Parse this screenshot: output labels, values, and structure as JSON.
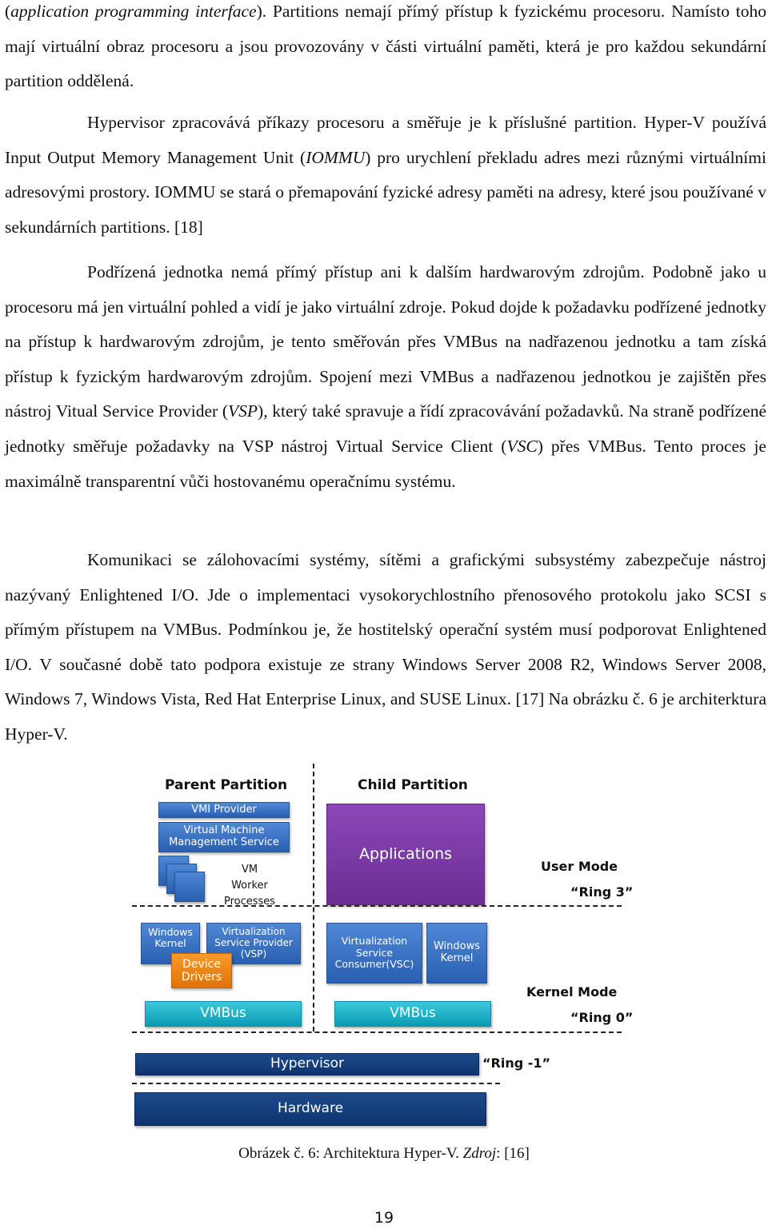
{
  "paragraphs": {
    "p1": {
      "italic_lead": "application programming interface",
      "open_paren": "(",
      "after_lead": "). Partitions nemají přímý přístup k fyzickému procesoru. Namísto toho mají virtuální obraz procesoru a jsou provozovány v části virtuální paměti, která je pro každou sekundární partition oddělená."
    },
    "p2": {
      "part1": "Hypervisor zpracovává příkazy procesoru a směřuje je k příslušné partition. Hyper-V používá Input Output Memory Management Unit (",
      "italic1": "IOMMU",
      "part2": ") pro urychlení překladu adres mezi různými virtuálními adresovými prostory. IOMMU se stará o přemapování fyzické adresy paměti na adresy, které jsou používané v sekundárních partitions. [18]"
    },
    "p3": {
      "part1": "Podřízená jednotka nemá přímý přístup ani k dalším hardwarovým zdrojům. Podobně jako u procesoru má jen virtuální pohled a vidí je jako virtuální zdroje. Pokud dojde k požadavku podřízené jednotky na přístup k hardwarovým zdrojům, je tento směřován přes VMBus na nadřazenou jednotku a tam získá přístup k fyzickým hardwarovým zdrojům. Spojení mezi VMBus a nadřazenou jednotkou je zajištěn přes nástroj Vitual Service Provider (",
      "italic1": "VSP",
      "part2": "), který také spravuje a řídí zpracovávání požadavků. Na straně podřízené jednotky směřuje požadavky na VSP nástroj Virtual Service Client (",
      "italic2": "VSC",
      "part3": ") přes VMBus. Tento proces je maximálně transparentní vůči hostovanému operačnímu systému."
    },
    "p4": {
      "text": "Komunikaci se zálohovacími systémy, sítěmi a grafickými subsystémy zabezpečuje nástroj nazývaný Enlightened I/O. Jde o implementaci vysokorychlostního přenosového protokolu jako SCSI s přímým přístupem na VMBus. Podmínkou je, že hostitelský operační systém musí podporovat Enlightened I/O. V současné době tato podpora existuje ze strany Windows Server 2008 R2, Windows Server 2008, Windows 7, Windows Vista, Red Hat Enterprise Linux, and SUSE Linux. [17] Na obrázku č. 6 je architerktura Hyper-V."
    }
  },
  "diagram": {
    "parent_title": "Parent Partition",
    "child_title": "Child Partition",
    "vmi_provider": "VMI Provider",
    "vmms_line1": "Virtual Machine",
    "vmms_line2": "Management Service",
    "vm_worker_line1": "VM",
    "vm_worker_line2": "Worker",
    "vm_worker_line3": "Processes",
    "applications": "Applications",
    "parent_kernel_line1": "Windows",
    "parent_kernel_line2": "Kernel",
    "vsp_line1": "Virtualization",
    "vsp_line2": "Service Provider",
    "vsp_line3": "(VSP)",
    "device_drivers_line1": "Device",
    "device_drivers_line2": "Drivers",
    "vsc_line1": "Virtualization",
    "vsc_line2": "Service",
    "vsc_line3": "Consumer(VSC)",
    "child_kernel_line1": "Windows",
    "child_kernel_line2": "Kernel",
    "parent_vmbus": "VMBus",
    "child_vmbus": "VMBus",
    "hypervisor": "Hypervisor",
    "hardware": "Hardware",
    "user_mode": "User Mode",
    "ring3": "“Ring 3”",
    "kernel_mode": "Kernel Mode",
    "ring0": "“Ring 0”",
    "ring_minus1": "“Ring -1”",
    "colors": {
      "blue": "#2f6ac0",
      "cyan": "#12a8c0",
      "purple": "#7a3aa6",
      "orange": "#f08418",
      "navy": "#143f7e"
    }
  },
  "caption": {
    "prefix": "Obrázek č. 6: Architektura Hyper-V. ",
    "source_label": "Zdroj",
    "suffix": ": [16]"
  },
  "page_number": "19"
}
